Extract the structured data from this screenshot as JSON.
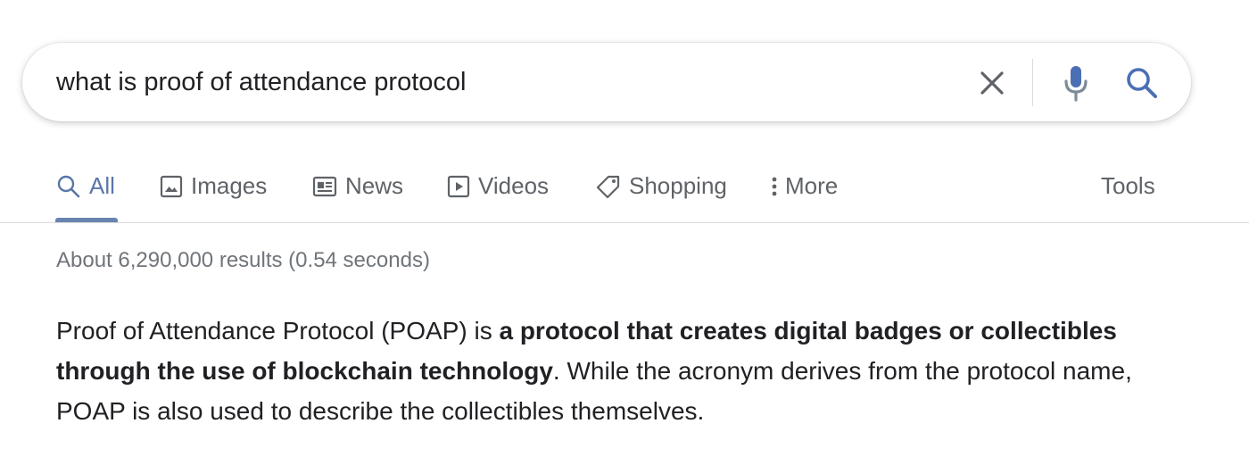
{
  "search": {
    "query": "what is proof of attendance protocol"
  },
  "tabs": [
    {
      "label": "All",
      "icon": "search-icon",
      "active": true
    },
    {
      "label": "Images",
      "icon": "image-icon"
    },
    {
      "label": "News",
      "icon": "news-icon"
    },
    {
      "label": "Videos",
      "icon": "play-icon"
    },
    {
      "label": "Shopping",
      "icon": "tag-icon"
    },
    {
      "label": "More",
      "icon": "kebab-vertical-icon"
    }
  ],
  "tools_label": "Tools",
  "result_stats": "About 6,290,000 results (0.54 seconds)",
  "snippet": {
    "text_before": "Proof of Attendance Protocol (POAP) is ",
    "bold": "a protocol that creates digital badges or collectibles through the use of blockchain technology",
    "text_after": ". While the acronym derives from the protocol name, POAP is also used to describe the collectibles themselves."
  },
  "colors": {
    "active_tab": "#5a76a8",
    "tab_text": "#5f6368",
    "stats_text": "#70757a",
    "body_text": "#202124"
  }
}
